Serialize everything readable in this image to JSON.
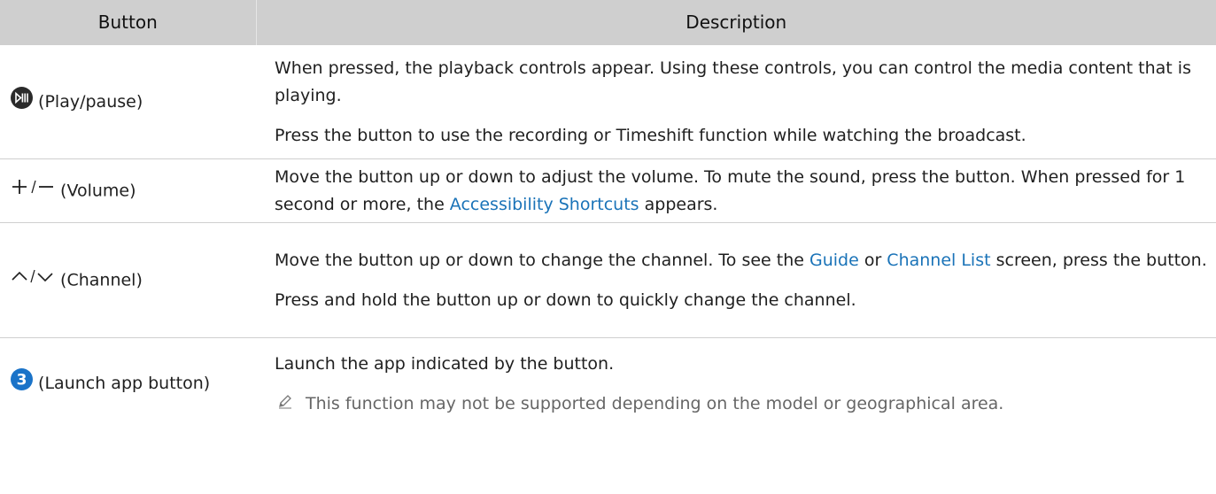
{
  "table": {
    "headers": [
      "Button",
      "Description"
    ],
    "rows": [
      {
        "button_label": "(Play/pause)",
        "icon": "play-pause-icon",
        "desc": [
          {
            "text": "When pressed, the playback controls appear. Using these controls, you can control the media content that is playing."
          },
          {
            "text": "Press the button to use the recording or Timeshift function while watching the broadcast."
          }
        ]
      },
      {
        "button_label": "(Volume)",
        "icon": "plus-minus-icon",
        "desc_pre": "Move the button up or down to adjust the volume. To mute the sound, press the button. When pressed for 1 second or more, the ",
        "desc_link": "Accessibility Shortcuts",
        "desc_post": " appears."
      },
      {
        "button_label": "(Channel)",
        "icon": "chevron-up-down-icon",
        "desc_pre": "Move the button up or down to change the channel. To see the ",
        "desc_link1": "Guide",
        "desc_mid": " or ",
        "desc_link2": "Channel List",
        "desc_post": " screen, press the button.",
        "desc2": "Press and hold the button up or down to quickly change the channel."
      },
      {
        "button_label": "(Launch app button)",
        "icon": "number-3-icon",
        "icon_text": "3",
        "desc": "Launch the app indicated by the button.",
        "note": "This function may not be supported depending on the model or geographical area."
      }
    ]
  },
  "colors": {
    "header_bg": "#cfcfcf",
    "link": "#1a73b8",
    "badge": "#1a73c8"
  }
}
